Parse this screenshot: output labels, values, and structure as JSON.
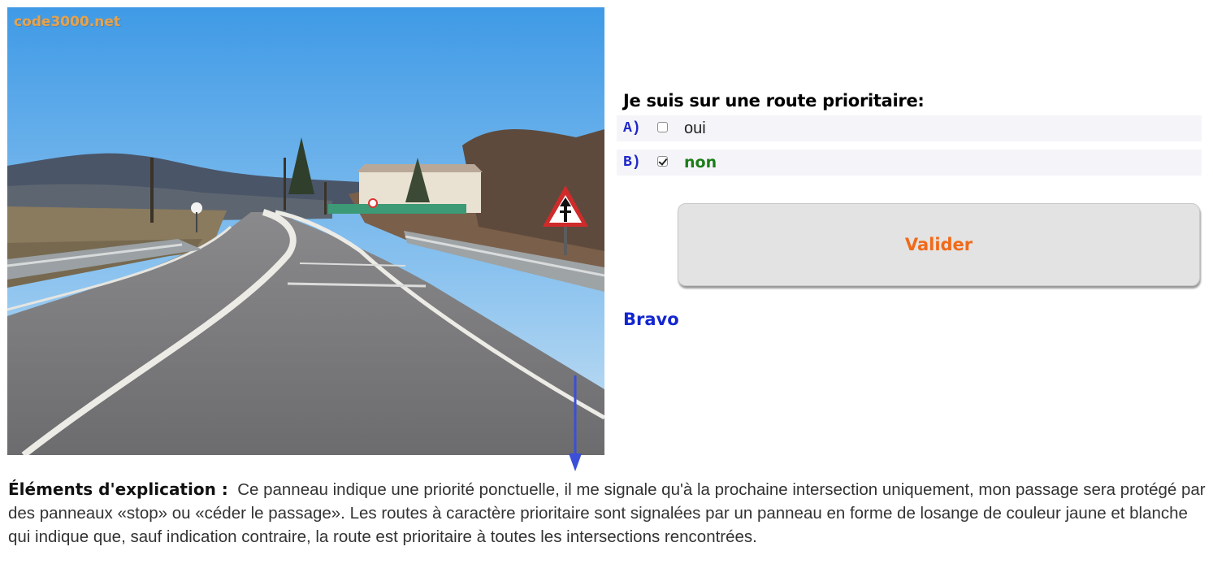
{
  "image": {
    "watermark": "code3000.net",
    "sign": "priorité ponctuelle"
  },
  "question": {
    "text": "Je suis sur une route prioritaire:",
    "answers": [
      {
        "letter": "A)",
        "label": "oui",
        "checked": false
      },
      {
        "letter": "B)",
        "label": "non",
        "checked": true
      }
    ]
  },
  "buttons": {
    "validate_label": "Valider"
  },
  "feedback": {
    "result": "Bravo"
  },
  "explanation": {
    "label": "Éléments d'explication :",
    "text": "Ce panneau indique une priorité ponctuelle, il me signale qu'à la prochaine intersection uniquement, mon passage sera protégé par des panneaux «stop» ou «céder le passage». Les routes à caractère prioritaire sont signalées par un panneau en forme de losange de couleur jaune et blanche qui indique que, sauf indication contraire, la route est prioritaire à toutes les intersections rencontrées."
  },
  "colors": {
    "question": "#000000",
    "letters": "#1f28c8",
    "correct_answer": "#1c7d18",
    "validate_text": "#f06a1a",
    "bravo": "#1326d0"
  }
}
